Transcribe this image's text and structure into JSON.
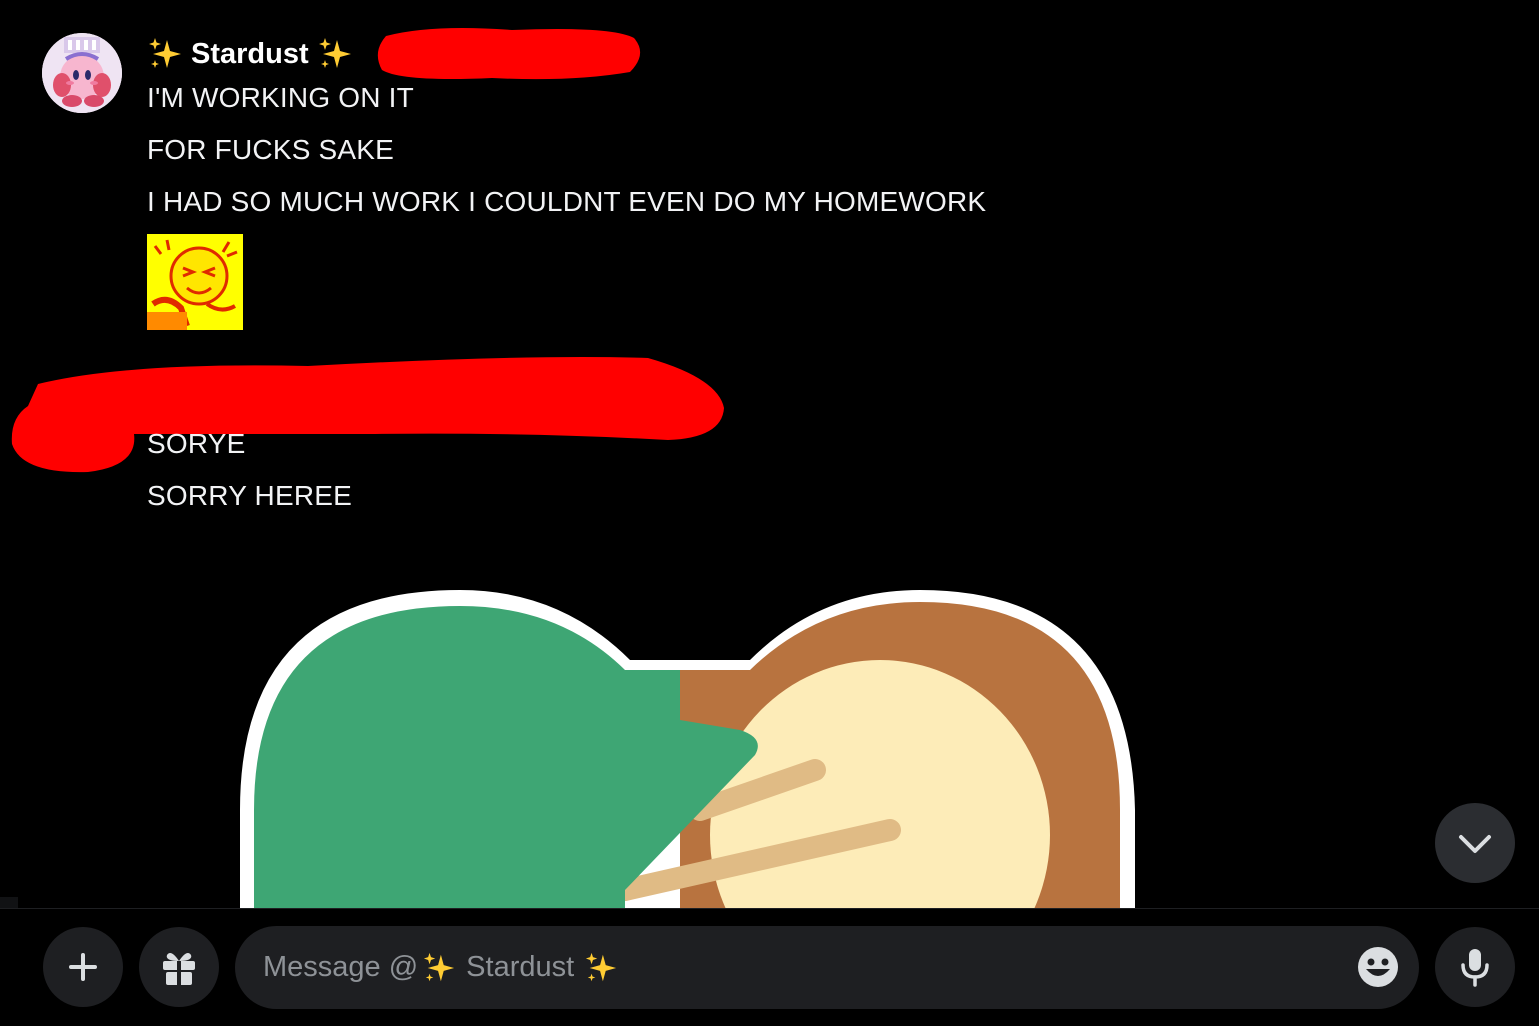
{
  "message": {
    "author": "Stardust",
    "author_prefix_icon": "sparkles-icon",
    "author_suffix_icon": "sparkles-icon",
    "lines": [
      "I'M WORKING ON IT",
      "FOR FUCKS SAKE",
      "I HAD SO MUCH WORK I COULDNT EVEN DO MY HOMEWORK"
    ],
    "custom_emoji": "yellow-laughing-face-emoji"
  },
  "message2": {
    "lines": [
      "SORYE",
      "SORRY HEREE"
    ]
  },
  "sticker": "green-and-tan-shape-sticker",
  "composer": {
    "placeholder_prefix": "Message @",
    "placeholder_name": "Stardust",
    "add_icon": "plus-icon",
    "gift_icon": "gift-icon",
    "emoji_icon": "smiley-icon",
    "mic_icon": "microphone-icon"
  },
  "colors": {
    "background": "#000000",
    "input_bg": "#1e1f22",
    "redaction": "#ff0000",
    "sparkle": "#ffcc33"
  }
}
